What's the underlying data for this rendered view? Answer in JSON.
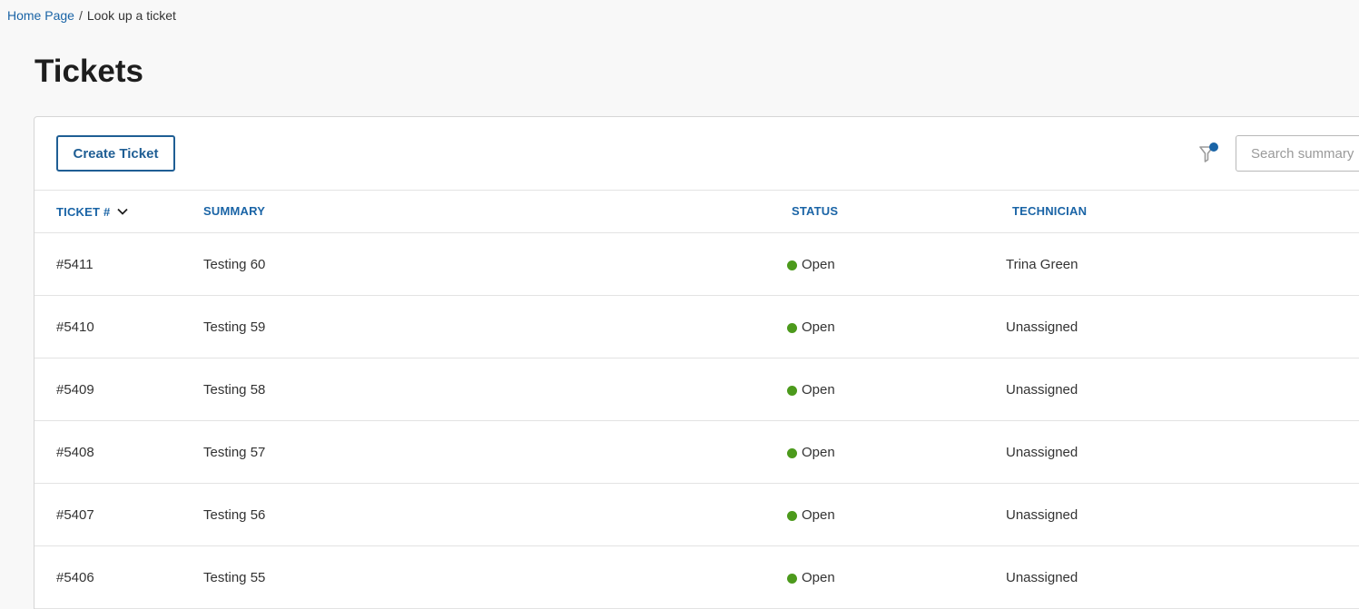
{
  "breadcrumb": {
    "home": "Home Page",
    "separator": "/",
    "current": "Look up a ticket"
  },
  "page": {
    "title": "Tickets"
  },
  "toolbar": {
    "create_label": "Create Ticket",
    "filter_icon": "filter-icon",
    "filter_active_color": "#1a64a6",
    "search_placeholder": "Search summary"
  },
  "table": {
    "columns": {
      "ticket": "TICKET #",
      "summary": "SUMMARY",
      "status": "STATUS",
      "technician": "TECHNICIAN"
    },
    "sort_indicator": "chevron-down-icon",
    "status_open_color": "#4c9a1c",
    "rows": [
      {
        "ticket": "#5411",
        "summary": "Testing 60",
        "status": "Open",
        "technician": "Trina Green"
      },
      {
        "ticket": "#5410",
        "summary": "Testing 59",
        "status": "Open",
        "technician": "Unassigned"
      },
      {
        "ticket": "#5409",
        "summary": "Testing 58",
        "status": "Open",
        "technician": "Unassigned"
      },
      {
        "ticket": "#5408",
        "summary": "Testing 57",
        "status": "Open",
        "technician": "Unassigned"
      },
      {
        "ticket": "#5407",
        "summary": "Testing 56",
        "status": "Open",
        "technician": "Unassigned"
      },
      {
        "ticket": "#5406",
        "summary": "Testing 55",
        "status": "Open",
        "technician": "Unassigned"
      }
    ]
  },
  "colors": {
    "accent": "#1a64a6",
    "button_border": "#1f5e94",
    "background": "#f8f8f8"
  }
}
